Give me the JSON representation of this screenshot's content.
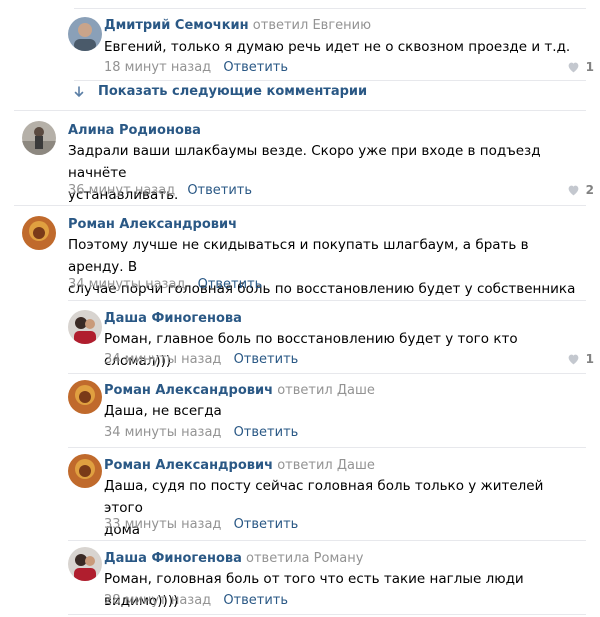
{
  "comments": [
    {
      "author": "Дмитрий Семочкин",
      "reply_to": "ответил Евгению",
      "text_lines": [
        "Евгений, только я думаю речь идет не о сквозном проезде и т.д."
      ],
      "time": "18 минут назад",
      "reply_label": "Ответить",
      "likes": "1"
    },
    {
      "author": "Алина Родионова",
      "reply_to": "",
      "text_lines": [
        "Задрали ваши шлакбаумы везде. Скоро уже при входе в подъезд начнёте",
        "устанавливать."
      ],
      "time": "36 минут назад",
      "reply_label": "Ответить",
      "likes": "2"
    },
    {
      "author": "Роман Александрович",
      "reply_to": "",
      "text_lines": [
        "Поэтому лучше не скидываться и покупать шлагбаум, а брать в аренду. В",
        "случае порчи головная боль по восстановлению будет у собственника"
      ],
      "time": "34 минуты назад",
      "reply_label": "Ответить",
      "likes": ""
    },
    {
      "author": "Даша Финогенова",
      "reply_to": "",
      "text_lines": [
        "Роман, главное боль по восстановлению будет у того кто сломал)))"
      ],
      "time": "34 минуты назад",
      "reply_label": "Ответить",
      "likes": "1"
    },
    {
      "author": "Роман Александрович",
      "reply_to": "ответил Даше",
      "text_lines": [
        "Даша, не всегда"
      ],
      "time": "34 минуты назад",
      "reply_label": "Ответить",
      "likes": ""
    },
    {
      "author": "Роман Александрович",
      "reply_to": "ответил Даше",
      "text_lines": [
        "Даша, судя по посту сейчас головная боль только у жителей этого",
        "дома"
      ],
      "time": "33 минуты назад",
      "reply_label": "Ответить",
      "likes": ""
    },
    {
      "author": "Даша Финогенова",
      "reply_to": "ответила Роману",
      "text_lines": [
        "Роман, головная боль от того что есть такие наглые люди видимо))))"
      ],
      "time": "28 минут назад",
      "reply_label": "Ответить",
      "likes": ""
    }
  ],
  "show_more_label": "Показать следующие комментарии",
  "icons": {
    "like": "heart-icon",
    "expand": "arrow-down-icon"
  },
  "colors": {
    "link": "#2a5885",
    "meta": "#939393",
    "divider": "#e7e8ec"
  }
}
